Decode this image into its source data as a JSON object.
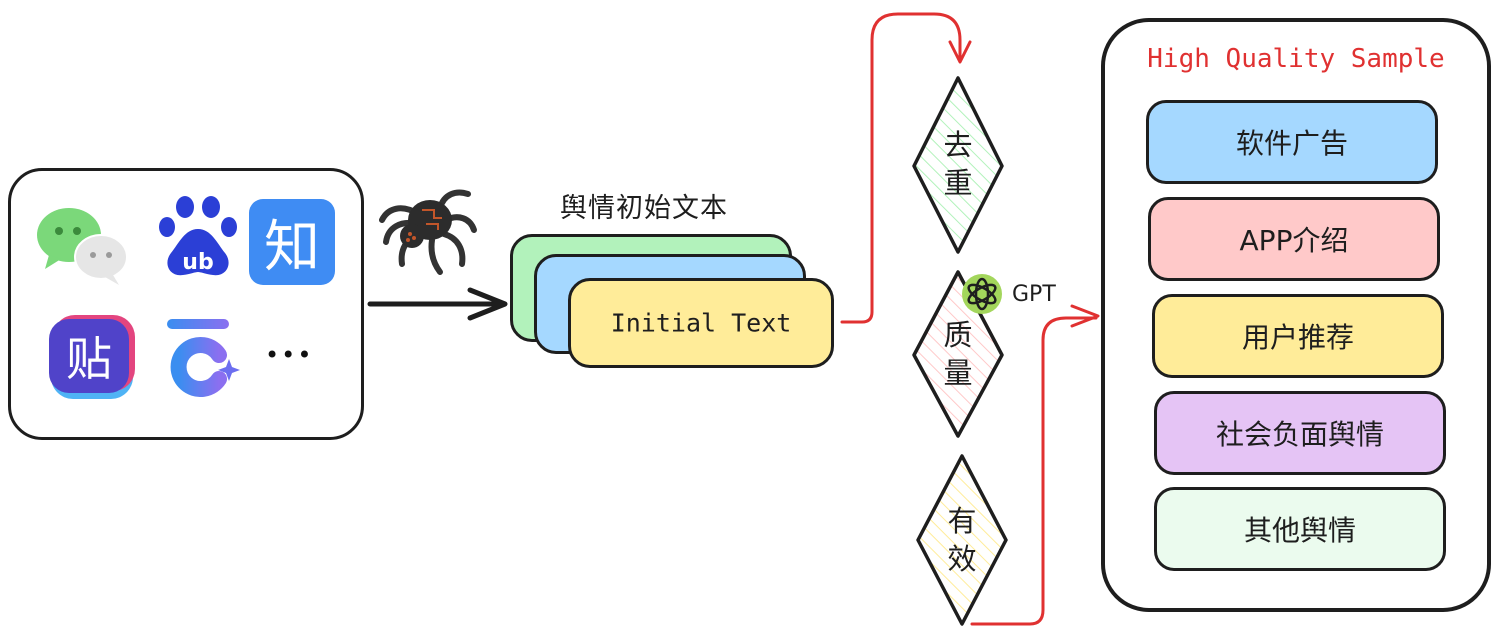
{
  "sources": {
    "apps": [
      {
        "name": "WeChat",
        "icon": "wechat-icon"
      },
      {
        "name": "Baidu",
        "icon": "baidu-paw-icon",
        "glyph": "ub"
      },
      {
        "name": "Zhihu",
        "icon": "zhihu-icon",
        "glyph": "知"
      },
      {
        "name": "Baidu Tieba",
        "icon": "tieba-icon",
        "glyph": "贴"
      },
      {
        "name": "Other app",
        "icon": "c-sparkle-icon"
      },
      {
        "name": "More",
        "icon": "ellipsis-icon",
        "glyph": "•••"
      }
    ],
    "crawler_icon": "spider-icon"
  },
  "initial_text": {
    "title": "舆情初始文本",
    "card_label": "Initial Text",
    "stack_colors": [
      "#b2f2bb",
      "#a5d8ff",
      "#ffec99"
    ]
  },
  "filters": [
    {
      "label_line1": "去",
      "label_line2": "重",
      "hatch_color": "#b2f2bb"
    },
    {
      "label_line1": "质",
      "label_line2": "量",
      "hatch_color": "#ffc9c9"
    },
    {
      "label_line1": "有",
      "label_line2": "效",
      "hatch_color": "#ffec99"
    }
  ],
  "gpt": {
    "label": "GPT",
    "icon": "openai-logo-icon",
    "color": "#a3d65c"
  },
  "output": {
    "title": "High Quality Sample",
    "title_color": "#e03131",
    "categories": [
      {
        "label": "软件广告",
        "color": "#a5d8ff"
      },
      {
        "label": "APP介绍",
        "color": "#ffc9c9"
      },
      {
        "label": "用户推荐",
        "color": "#ffec99"
      },
      {
        "label": "社会负面舆情",
        "color": "#e5c4f5"
      },
      {
        "label": "其他舆情",
        "color": "#ebfbee"
      }
    ]
  },
  "colors": {
    "stroke": "#1e1e1e",
    "flow_arrow": "#e03131"
  }
}
